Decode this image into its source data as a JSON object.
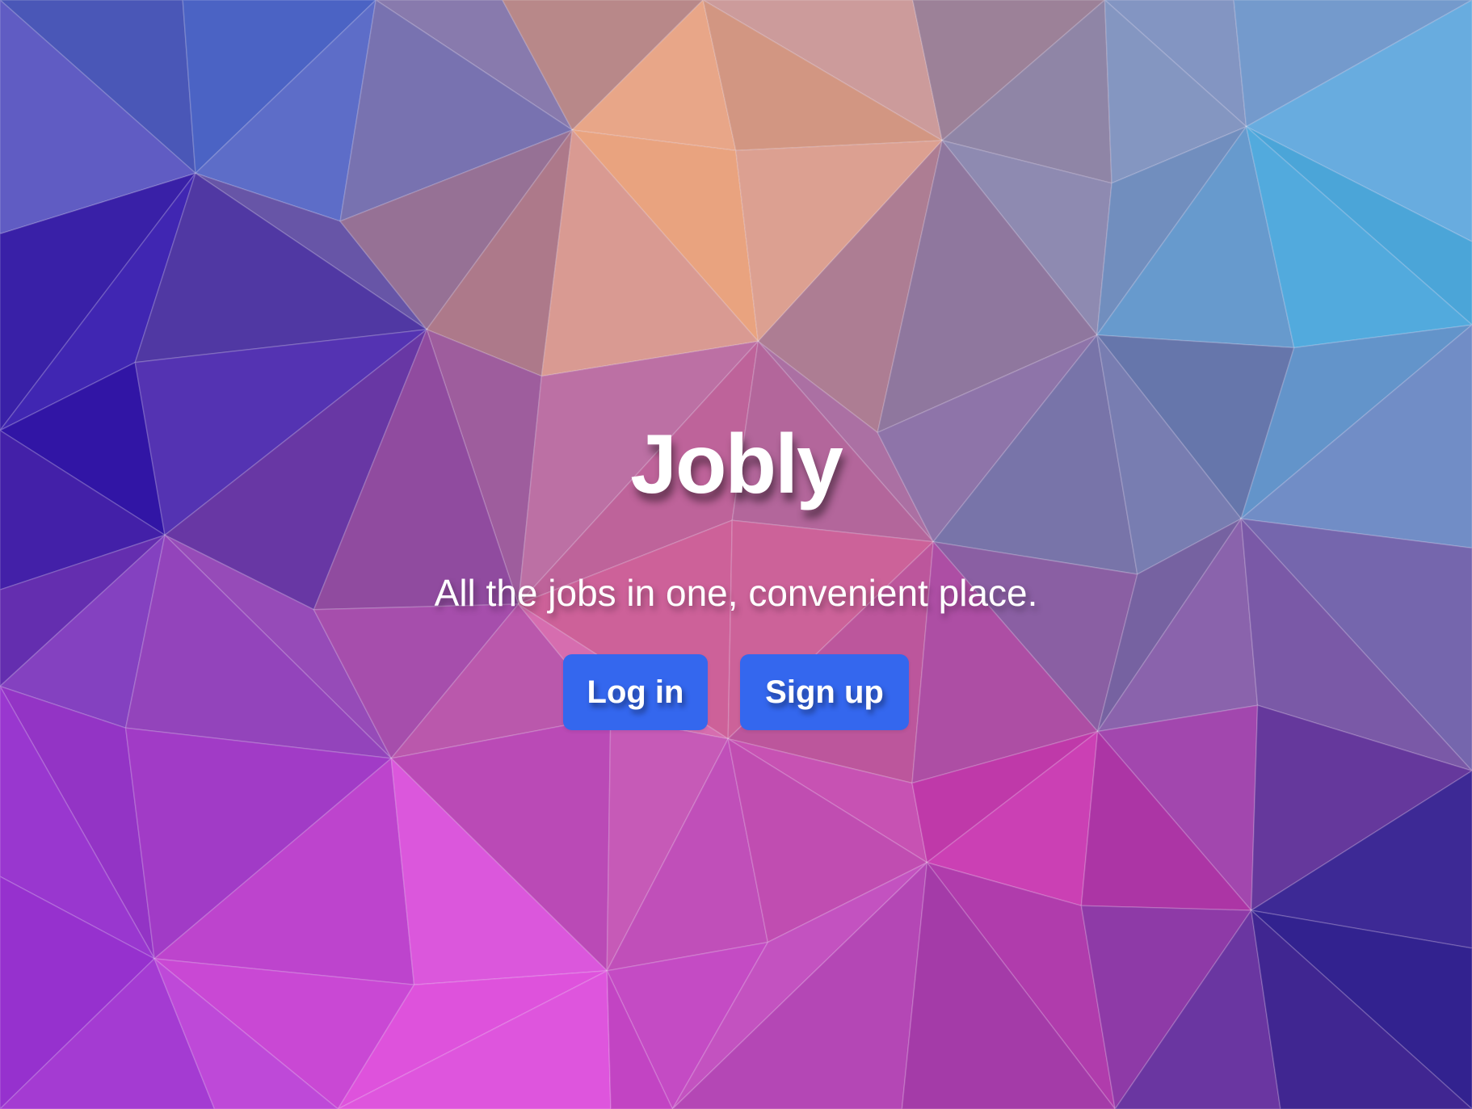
{
  "app": {
    "title": "Jobly",
    "tagline": "All the jobs in one, convenient place."
  },
  "actions": {
    "login_label": "Log in",
    "signup_label": "Sign up"
  },
  "colors": {
    "button_bg": "#3467ee",
    "text": "#ffffff"
  }
}
